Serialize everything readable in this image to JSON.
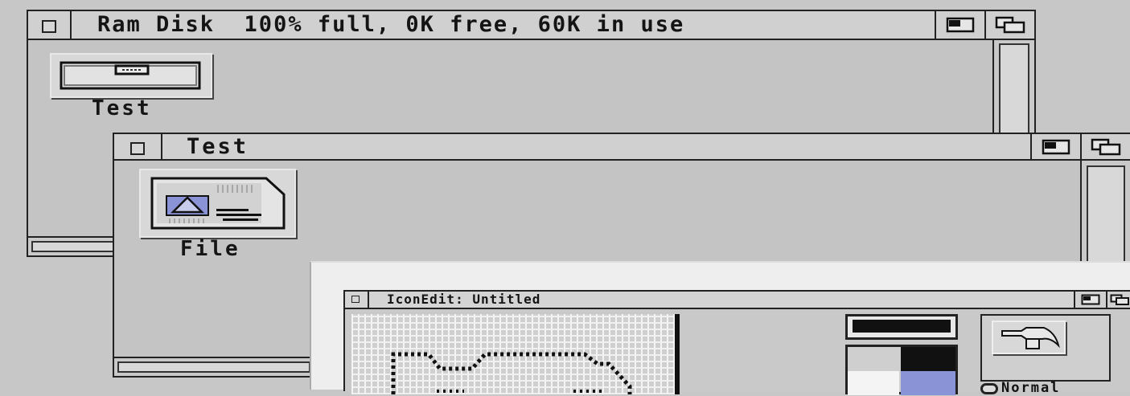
{
  "ram_disk_window": {
    "title": "Ram Disk  100% full, 0K free, 60K in use"
  },
  "test_window": {
    "title": "Test"
  },
  "drawer_icon": {
    "label": "Test",
    "icon": "drawer-icon"
  },
  "file_icon": {
    "label": "File",
    "icon": "project-file-icon"
  },
  "iconedit_window": {
    "title": "IconEdit: Untitled",
    "palette_colors": [
      "#111111",
      "#f4f4f4",
      "#111111",
      "#8a93d6"
    ],
    "tool_icon": "hammer-icon",
    "partial_label": "Normal"
  },
  "colors": {
    "desktop": "#c7c7c7",
    "window_border": "#222222",
    "accent_blue": "#8a93d6"
  }
}
